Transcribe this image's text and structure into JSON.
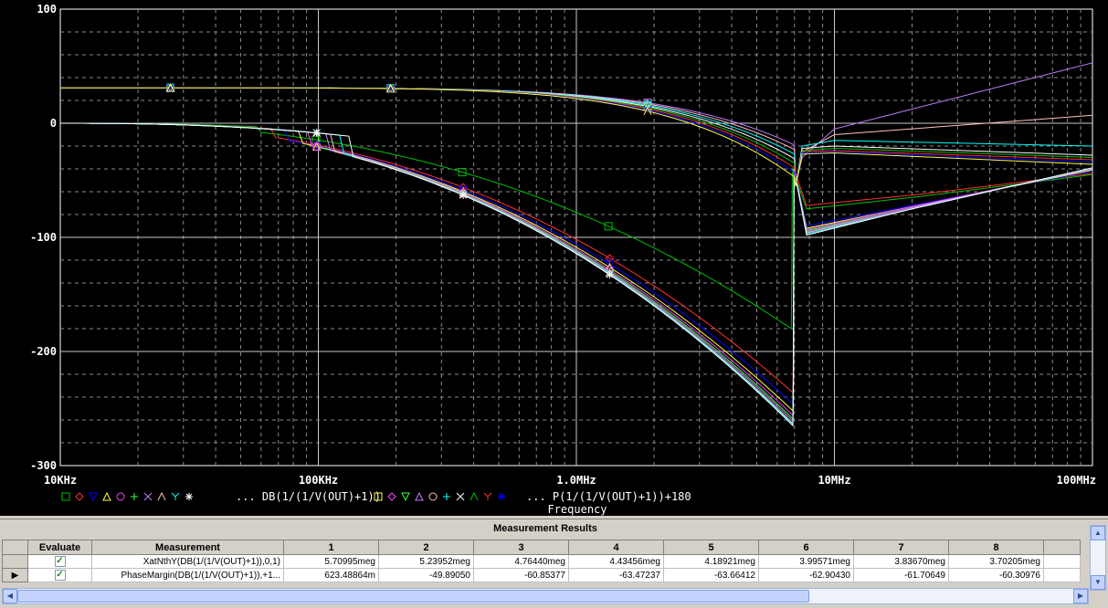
{
  "chart_data": {
    "type": "line",
    "x_scale": "log",
    "xlim": [
      10000,
      100000000
    ],
    "ylim": [
      -300,
      100
    ],
    "y_ticks": [
      {
        "v": 100,
        "label": "100"
      },
      {
        "v": 0,
        "label": "0"
      },
      {
        "v": -100,
        "label": "-100"
      },
      {
        "v": -200,
        "label": "-200"
      },
      {
        "v": -300,
        "label": "-300"
      }
    ],
    "x_ticks": [
      {
        "v": 10000,
        "label": "10KHz"
      },
      {
        "v": 100000,
        "label": "100KHz"
      },
      {
        "v": 1000000,
        "label": "1.0MHz"
      },
      {
        "v": 10000000,
        "label": "10MHz"
      },
      {
        "v": 100000000,
        "label": "100MHz"
      }
    ],
    "xlabel": "Frequency",
    "grid": true,
    "legend_text_1": "... DB(1/(1/V(OUT)+1))",
    "legend_text_2": "... P(1/(1/V(OUT)+1))+180",
    "colors": [
      "#00c000",
      "#ff3030",
      "#0000ff",
      "#ffff40",
      "#ff40ff",
      "#40ff40",
      "#c080ff",
      "#ffc0c0",
      "#00ffff",
      "#ffffff"
    ],
    "magnitude_series": [
      {
        "min_f": 6800000,
        "min_y": -180,
        "hf": [
          [
            7800000,
            -75
          ],
          [
            20000000,
            -65
          ],
          [
            100000000,
            -45
          ]
        ]
      },
      {
        "min_f": 6900000,
        "min_y": -236,
        "hf": [
          [
            7800000,
            -72
          ],
          [
            20000000,
            -63
          ],
          [
            100000000,
            -44
          ]
        ]
      },
      {
        "min_f": 6900000,
        "min_y": -246,
        "hf": [
          [
            7800000,
            -90
          ],
          [
            20000000,
            -72
          ],
          [
            100000000,
            -42
          ]
        ]
      },
      {
        "min_f": 6900000,
        "min_y": -252,
        "hf": [
          [
            7800000,
            -92
          ],
          [
            20000000,
            -73
          ],
          [
            100000000,
            -41
          ]
        ]
      },
      {
        "min_f": 6900000,
        "min_y": -256,
        "hf": [
          [
            7800000,
            -93
          ],
          [
            20000000,
            -73
          ],
          [
            100000000,
            -40
          ]
        ]
      },
      {
        "min_f": 6900000,
        "min_y": -259,
        "hf": [
          [
            7800000,
            -94
          ],
          [
            20000000,
            -74
          ],
          [
            100000000,
            -40
          ]
        ]
      },
      {
        "min_f": 6900000,
        "min_y": -261,
        "hf": [
          [
            7800000,
            -95
          ],
          [
            20000000,
            -74
          ],
          [
            100000000,
            -40
          ]
        ]
      },
      {
        "min_f": 6900000,
        "min_y": -263,
        "hf": [
          [
            7800000,
            -96
          ],
          [
            20000000,
            -75
          ],
          [
            100000000,
            -39
          ]
        ]
      },
      {
        "min_f": 6900000,
        "min_y": -264,
        "hf": [
          [
            7800000,
            -97
          ],
          [
            20000000,
            -75
          ],
          [
            100000000,
            -39
          ]
        ]
      },
      {
        "min_f": 6900000,
        "min_y": -265,
        "hf": [
          [
            7800000,
            -98
          ],
          [
            20000000,
            -75
          ],
          [
            100000000,
            -39
          ]
        ]
      }
    ],
    "phase_series": [
      {
        "hf": [
          [
            7500000,
            -30
          ],
          [
            10000000,
            -5
          ],
          [
            100000000,
            53
          ]
        ]
      },
      {
        "hf": [
          [
            7500000,
            -25
          ],
          [
            10000000,
            -10
          ],
          [
            100000000,
            7
          ]
        ]
      },
      {
        "hf": [
          [
            7500000,
            -20
          ],
          [
            10000000,
            -15
          ],
          [
            100000000,
            -20
          ]
        ]
      },
      {
        "hf": [
          [
            7500000,
            -22
          ],
          [
            10000000,
            -20
          ],
          [
            100000000,
            -28
          ]
        ]
      },
      {
        "hf": [
          [
            7500000,
            -24
          ],
          [
            10000000,
            -22
          ],
          [
            100000000,
            -30
          ]
        ]
      },
      {
        "hf": [
          [
            7500000,
            -25
          ],
          [
            10000000,
            -24
          ],
          [
            100000000,
            -32
          ]
        ]
      },
      {
        "hf": [
          [
            7500000,
            -26
          ],
          [
            10000000,
            -25
          ],
          [
            100000000,
            -34
          ]
        ]
      },
      {
        "hf": [
          [
            7500000,
            -27
          ],
          [
            10000000,
            -26
          ],
          [
            100000000,
            -36
          ]
        ]
      }
    ]
  },
  "results": {
    "title": "Measurement Results",
    "headers": [
      "Evaluate",
      "Measurement",
      "1",
      "2",
      "3",
      "4",
      "5",
      "6",
      "7",
      "8"
    ],
    "rows": [
      {
        "selected": false,
        "evaluate": true,
        "measurement": "XatNthY(DB(1/(1/V(OUT)+1)),0,1)",
        "values": [
          "5.70995meg",
          "5.23952meg",
          "4.76440meg",
          "4.43456meg",
          "4.18921meg",
          "3.99571meg",
          "3.83670meg",
          "3.70205meg"
        ]
      },
      {
        "selected": true,
        "evaluate": true,
        "measurement": "PhaseMargin(DB(1/(1/V(OUT)+1)),+1...",
        "values": [
          "623.48864m",
          "-49.89050",
          "-60.85377",
          "-63.47237",
          "-63.66412",
          "-62.90430",
          "-61.70649",
          "-60.30976"
        ]
      }
    ]
  }
}
